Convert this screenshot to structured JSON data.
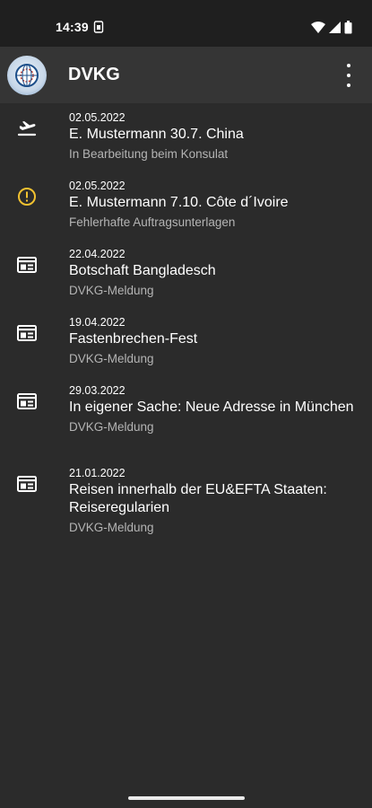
{
  "status_bar": {
    "time": "14:39",
    "icons": [
      "sim-card-icon",
      "wifi-icon",
      "signal-icon",
      "battery-icon"
    ]
  },
  "app_bar": {
    "title": "DVKG",
    "logo_icon": "globe-logo-icon",
    "menu_icon": "more-vert-icon"
  },
  "items": [
    {
      "icon": "airplane-departure-icon",
      "date": "02.05.2022",
      "title": "E. Mustermann 30.7. China",
      "subtitle": "In Bearbeitung beim Konsulat"
    },
    {
      "icon": "warning-circle-icon",
      "date": "02.05.2022",
      "title": "E. Mustermann 7.10. Côte d´Ivoire",
      "subtitle": "Fehlerhafte Auftragsunterlagen"
    },
    {
      "icon": "newspaper-icon",
      "date": "22.04.2022",
      "title": "Botschaft Bangladesch",
      "subtitle": "DVKG-Meldung"
    },
    {
      "icon": "newspaper-icon",
      "date": "19.04.2022",
      "title": "Fastenbrechen-Fest",
      "subtitle": "DVKG-Meldung"
    },
    {
      "icon": "newspaper-icon",
      "date": "29.03.2022",
      "title": "In eigener Sache: Neue Adresse in München",
      "subtitle": "DVKG-Meldung"
    },
    {
      "icon": "newspaper-icon",
      "date": "21.01.2022",
      "title": "Reisen innerhalb der EU&EFTA Staaten: Reiseregularien",
      "subtitle": "DVKG-Meldung"
    }
  ],
  "colors": {
    "background": "#2b2b2b",
    "app_bar": "#353535",
    "status_bar": "#1f1f1f",
    "warning": "#f2c230",
    "subtitle": "#b4b4b4"
  }
}
